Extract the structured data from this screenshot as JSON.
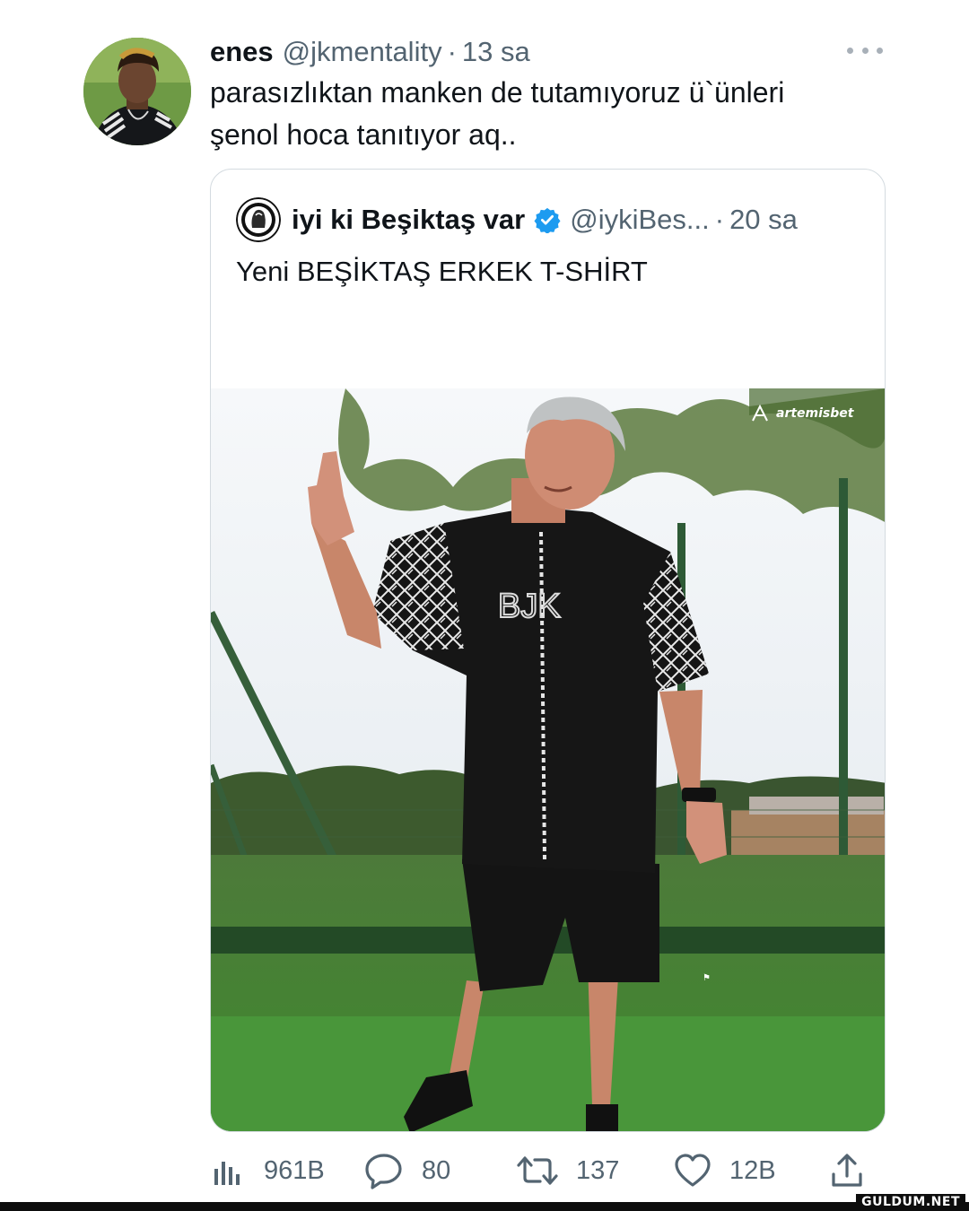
{
  "tweet": {
    "author_name": "enes",
    "author_handle": "@jkmentality",
    "separator": "·",
    "time": "13 sa",
    "text": "parasızlıktan manken de tutamıyoruz ü`ünleri\nşenol hoca tanıtıyor aq..",
    "more_icon": "more-horizontal-icon"
  },
  "quote": {
    "author_name": "iyi ki Beşiktaş var",
    "verified_icon": "verified-badge-icon",
    "author_handle": "@iykiBes...",
    "separator": "·",
    "time": "20 sa",
    "text": "Yeni BEŞİKTAŞ ERKEK T-SHİRT",
    "photo_watermark": "artemisbet",
    "shirt_print": "BJK"
  },
  "actions": {
    "views": {
      "icon": "views-chart-icon",
      "count": "961B"
    },
    "replies": {
      "icon": "reply-icon",
      "count": "80"
    },
    "retweets": {
      "icon": "retweet-icon",
      "count": "137"
    },
    "likes": {
      "icon": "heart-icon",
      "count": "12B"
    },
    "share": {
      "icon": "share-icon"
    }
  },
  "site_watermark": "GULDUM.NET",
  "colors": {
    "text_primary": "#0f1419",
    "text_secondary": "#536471",
    "verified_blue": "#1d9bf0",
    "card_border": "#d4dbe0"
  }
}
